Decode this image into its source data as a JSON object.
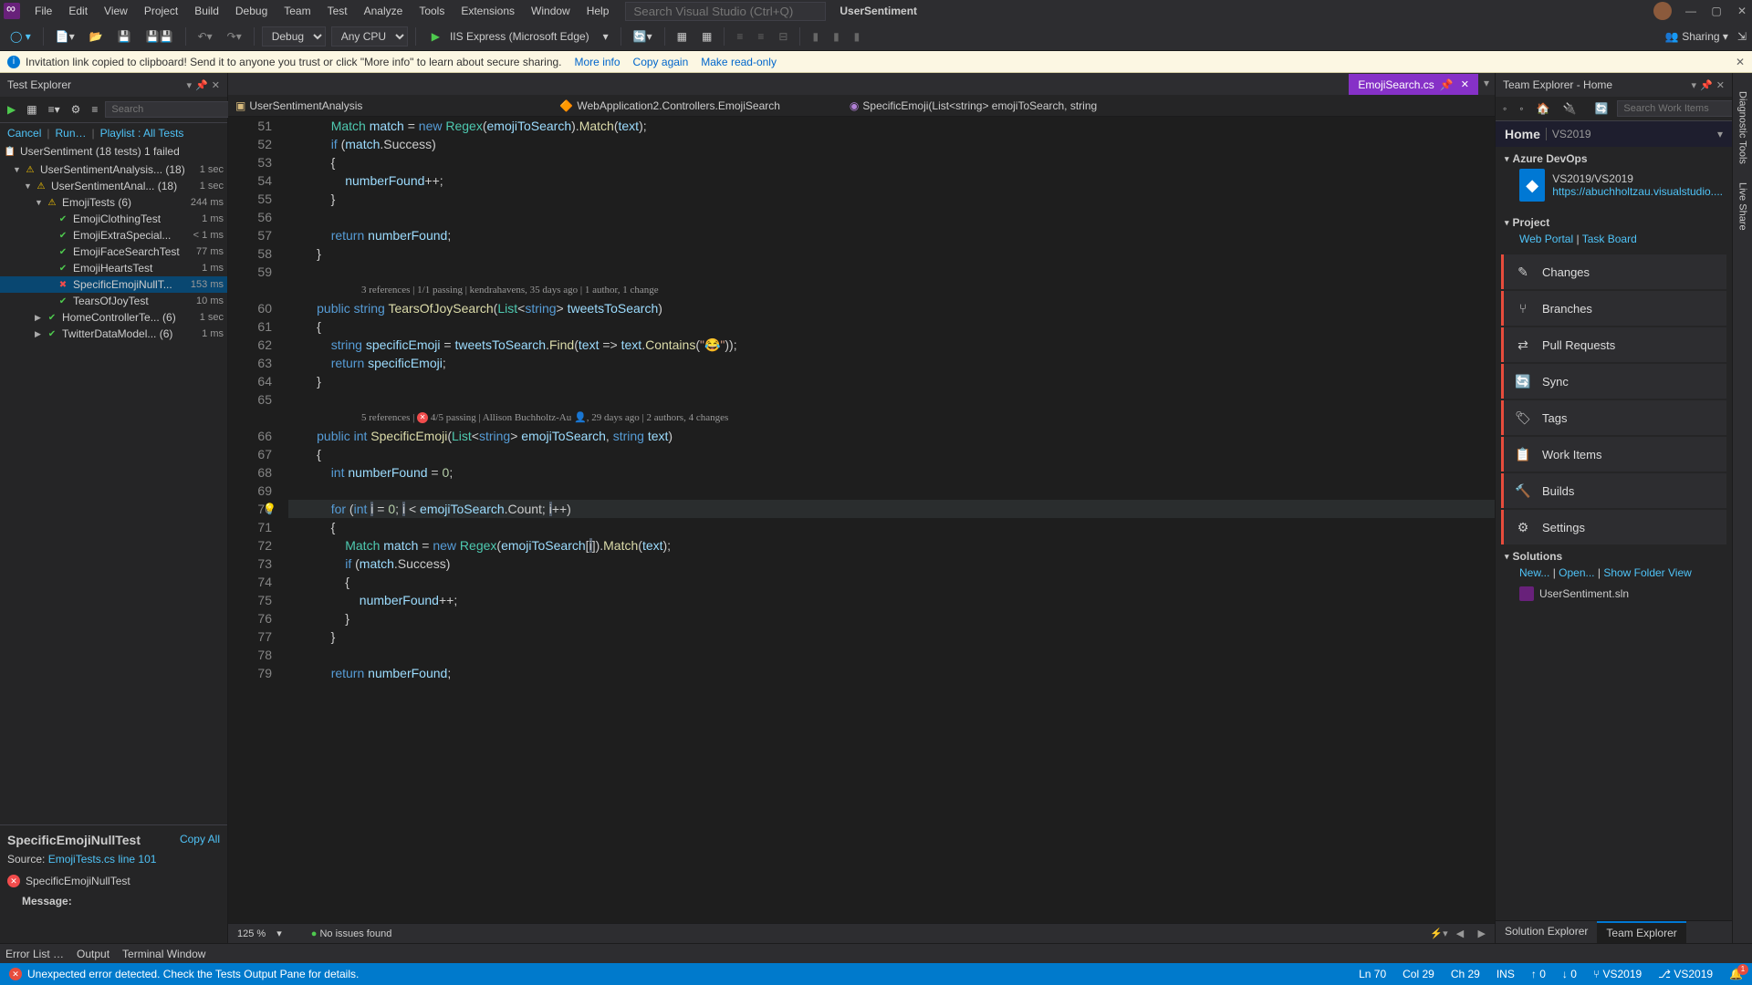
{
  "menu": [
    "File",
    "Edit",
    "View",
    "Project",
    "Build",
    "Debug",
    "Team",
    "Test",
    "Analyze",
    "Tools",
    "Extensions",
    "Window",
    "Help"
  ],
  "searchPlaceholder": "Search Visual Studio (Ctrl+Q)",
  "appName": "UserSentiment",
  "toolbar": {
    "config": "Debug",
    "platform": "Any CPU",
    "runLabel": "IIS Express (Microsoft Edge)",
    "sharing": "Sharing"
  },
  "infobar": {
    "text": "Invitation link copied to clipboard! Send it to anyone you trust or click \"More info\" to learn about secure sharing.",
    "moreInfo": "More info",
    "copyAgain": "Copy again",
    "makeReadonly": "Make read-only"
  },
  "testExplorer": {
    "title": "Test Explorer",
    "searchPlaceholder": "Search",
    "actions": {
      "cancel": "Cancel",
      "run": "Run…",
      "playlist": "Playlist : All Tests"
    },
    "root": {
      "label": "UserSentiment (18 tests) 1 failed"
    },
    "tree": [
      {
        "indent": 1,
        "arrow": "▼",
        "icon": "warn",
        "label": "UserSentimentAnalysis... (18)",
        "time": "1 sec"
      },
      {
        "indent": 2,
        "arrow": "▼",
        "icon": "warn",
        "label": "UserSentimentAnal... (18)",
        "time": "1 sec"
      },
      {
        "indent": 3,
        "arrow": "▼",
        "icon": "warn",
        "label": "EmojiTests (6)",
        "time": "244 ms"
      },
      {
        "indent": 4,
        "arrow": "",
        "icon": "pass",
        "label": "EmojiClothingTest",
        "time": "1 ms"
      },
      {
        "indent": 4,
        "arrow": "",
        "icon": "pass",
        "label": "EmojiExtraSpecial...",
        "time": "< 1 ms"
      },
      {
        "indent": 4,
        "arrow": "",
        "icon": "pass",
        "label": "EmojiFaceSearchTest",
        "time": "77 ms"
      },
      {
        "indent": 4,
        "arrow": "",
        "icon": "pass",
        "label": "EmojiHeartsTest",
        "time": "1 ms"
      },
      {
        "indent": 4,
        "arrow": "",
        "icon": "fail",
        "label": "SpecificEmojiNullT...",
        "time": "153 ms",
        "selected": true
      },
      {
        "indent": 4,
        "arrow": "",
        "icon": "pass",
        "label": "TearsOfJoyTest",
        "time": "10 ms"
      },
      {
        "indent": 3,
        "arrow": "▶",
        "icon": "pass",
        "label": "HomeControllerTe... (6)",
        "time": "1 sec"
      },
      {
        "indent": 3,
        "arrow": "▶",
        "icon": "pass",
        "label": "TwitterDataModel... (6)",
        "time": "1 ms"
      }
    ],
    "detail": {
      "title": "SpecificEmojiNullTest",
      "copyAll": "Copy All",
      "sourceLabel": "Source:",
      "sourceLink": "EmojiTests.cs line 101",
      "failName": "SpecificEmojiNullTest",
      "messageLabel": "Message:"
    }
  },
  "editor": {
    "tab": {
      "name": "EmojiSearch.cs"
    },
    "breadcrumbs": [
      "UserSentimentAnalysis",
      "WebApplication2.Controllers.EmojiSearch",
      "SpecificEmoji(List<string> emojiToSearch, string"
    ],
    "zoom": "125 %",
    "issues": "No issues found"
  },
  "codelens1": "3 references | 1/1 passing | kendrahavens, 35 days ago | 1 author, 1 change",
  "codelens2a": "5 references | ",
  "codelens2b": " 4/5 passing | Allison Buchholtz-Au ",
  "codelens2c": ", 29 days ago | 2 authors, 4 changes",
  "code": {
    "lineStart": 51
  },
  "teamExplorer": {
    "title": "Team Explorer - Home",
    "searchPlaceholder": "Search Work Items",
    "homeLabel": "Home",
    "homeSub": "VS2019",
    "azureHead": "Azure DevOps",
    "azureName": "VS2019/VS2019",
    "azureUrl": "https://abuchholtzau.visualstudio....",
    "projectHead": "Project",
    "webPortal": "Web Portal",
    "taskBoard": "Task Board",
    "tiles": [
      "Changes",
      "Branches",
      "Pull Requests",
      "Sync",
      "Tags",
      "Work Items",
      "Builds",
      "Settings"
    ],
    "solutionsHead": "Solutions",
    "new": "New...",
    "open": "Open...",
    "showFolder": "Show Folder View",
    "sln": "UserSentiment.sln",
    "bottomTabs": [
      "Solution Explorer",
      "Team Explorer"
    ]
  },
  "rightRail": [
    "Diagnostic Tools",
    "Live Share"
  ],
  "outputTabs": [
    "Error List …",
    "Output",
    "Terminal Window"
  ],
  "statusbar": {
    "msg": "Unexpected error detected. Check the Tests Output Pane for details.",
    "ln": "Ln 70",
    "col": "Col 29",
    "ch": "Ch 29",
    "ins": "INS",
    "up": "0",
    "down": "0",
    "repo1": "VS2019",
    "repo2": "VS2019",
    "notif": "1"
  }
}
